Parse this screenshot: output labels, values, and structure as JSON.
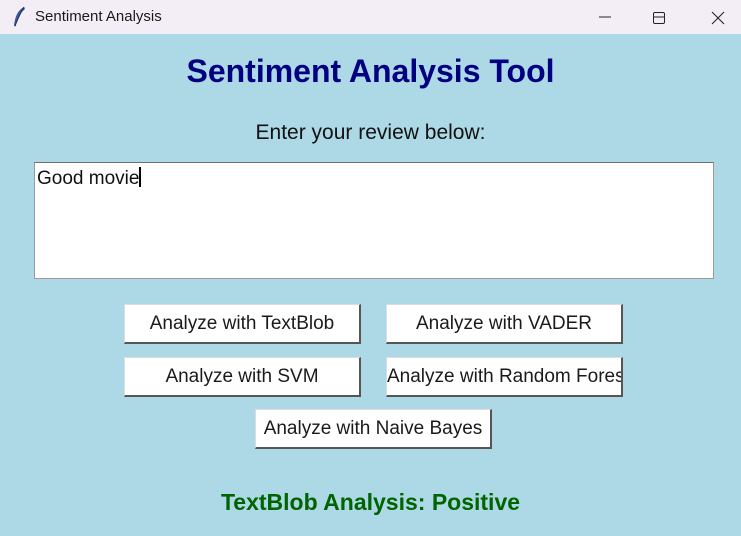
{
  "window": {
    "title": "Sentiment Analysis",
    "icon": "feather-icon",
    "controls": [
      "minimize-icon",
      "maximize-icon",
      "close-icon"
    ]
  },
  "app": {
    "heading": "Sentiment Analysis Tool",
    "prompt": "Enter your review below:",
    "review_text": "Good movie",
    "buttons": {
      "textblob": "Analyze with TextBlob",
      "vader": "Analyze with VADER",
      "svm": "Analyze with SVM",
      "random_forest": "Analyze with Random Fores",
      "naive_bayes": "Analyze with Naive Bayes"
    },
    "result": "TextBlob Analysis: Positive"
  },
  "colors": {
    "background": "#add8e6",
    "heading": "#000080",
    "result": "#006400"
  }
}
